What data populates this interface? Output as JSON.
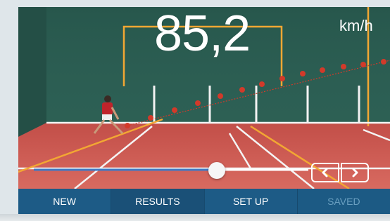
{
  "speed": {
    "value": "85,2",
    "unit": "km/h"
  },
  "playback": {
    "position": 0.53
  },
  "toolbar": {
    "new_label": "NEW",
    "results_label": "RESULTS",
    "setup_label": "SET UP",
    "saved_label": "SAVED"
  },
  "colors": {
    "court": "#c9534f",
    "wall": "#2b5d52",
    "toolbar": "#1d5b86",
    "trajectory": "#d23a2a",
    "court_lines": "#f2a733"
  }
}
